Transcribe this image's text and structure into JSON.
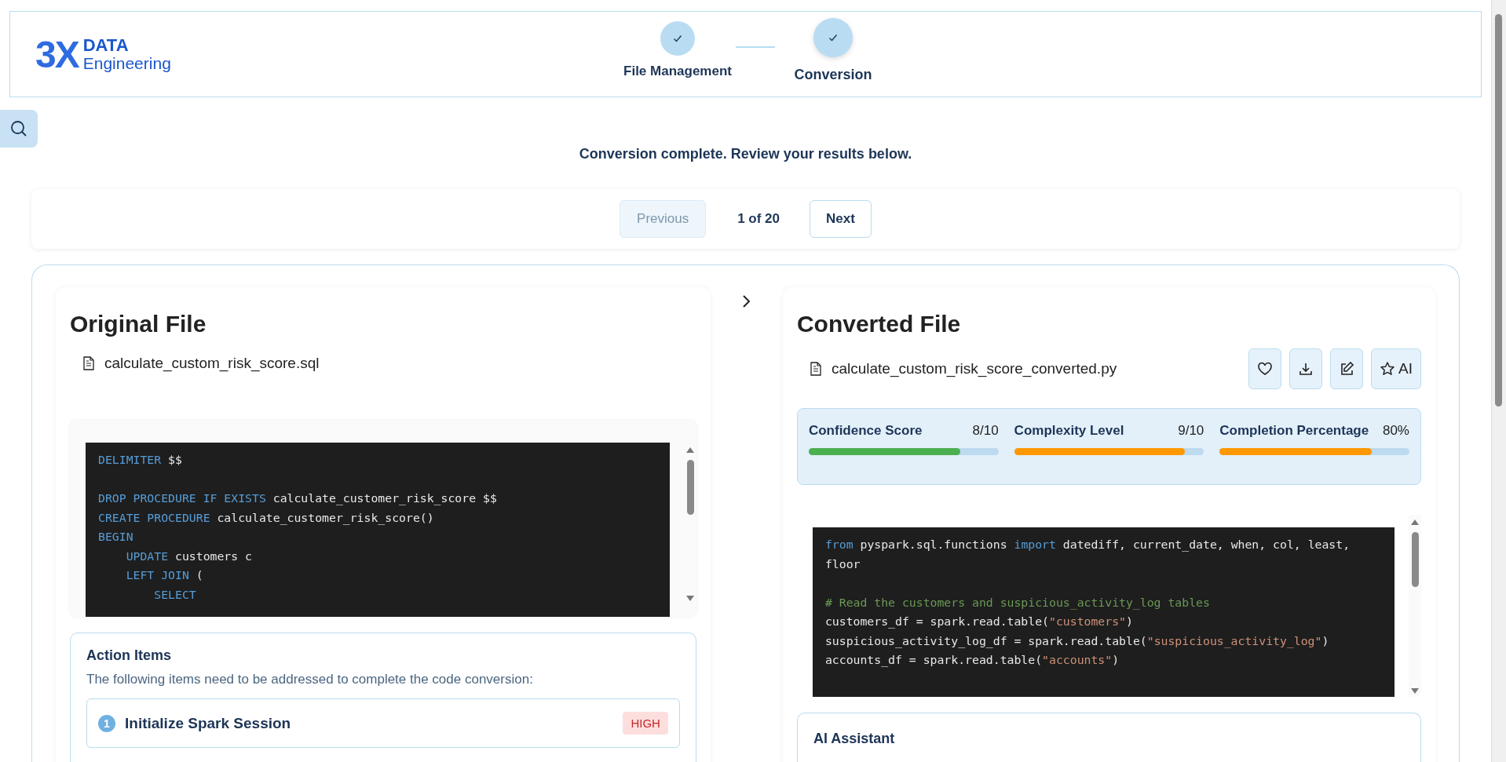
{
  "header": {
    "logo": {
      "mark": "3X",
      "line_1": "DATA",
      "line_2": "Engineering"
    },
    "steps": [
      {
        "label": "File Management",
        "done": true,
        "selected": false
      },
      {
        "label": "Conversion",
        "done": true,
        "selected": true
      }
    ]
  },
  "status_message": "Conversion complete. Review your results below.",
  "pagination": {
    "previous": {
      "label": "Previous",
      "disabled": true
    },
    "position": "1 of 20",
    "next": {
      "label": "Next",
      "disabled": false
    }
  },
  "original": {
    "title": "Original File",
    "file_name": "calculate_custom_risk_score.sql",
    "code": [
      {
        "tokens": [
          {
            "kind": "keyword",
            "text": "DELIMITER"
          },
          {
            "kind": "plain",
            "text": " $$"
          }
        ]
      },
      {
        "gap_before": true,
        "tokens": [
          {
            "kind": "keyword",
            "text": "DROP PROCEDURE IF EXISTS"
          },
          {
            "kind": "plain",
            "text": " calculate_customer_risk_score $$"
          }
        ]
      },
      {
        "tokens": [
          {
            "kind": "keyword",
            "text": "CREATE PROCEDURE"
          },
          {
            "kind": "plain",
            "text": " calculate_customer_risk_score()"
          }
        ]
      },
      {
        "tokens": [
          {
            "kind": "keyword",
            "text": "BEGIN"
          }
        ]
      },
      {
        "tokens": [
          {
            "kind": "keyword",
            "text": "    UPDATE"
          },
          {
            "kind": "plain",
            "text": " customers c"
          }
        ]
      },
      {
        "tokens": [
          {
            "kind": "keyword",
            "text": "    LEFT JOIN"
          },
          {
            "kind": "plain",
            "text": " ("
          }
        ]
      },
      {
        "tokens": [
          {
            "kind": "keyword",
            "text": "        SELECT"
          }
        ]
      }
    ],
    "action_items": {
      "title": "Action Items",
      "intro": "The following items need to be addressed to complete the code conversion:",
      "items": [
        {
          "number": "1",
          "title": "Initialize Spark Session",
          "priority": "HIGH",
          "color": "#fddede"
        }
      ]
    }
  },
  "converted": {
    "title": "Converted File",
    "file_name": "calculate_custom_risk_score_converted.py",
    "actions": [
      {
        "kind": "favorite"
      },
      {
        "kind": "download"
      },
      {
        "kind": "edit"
      },
      {
        "kind": "ai",
        "label": "AI"
      }
    ],
    "metrics": [
      {
        "label": "Confidence Score",
        "reading": "8/10",
        "level": 0.8,
        "color": "#4caf50"
      },
      {
        "label": "Complexity Level",
        "reading": "9/10",
        "level": 0.9,
        "color": "#ff9800"
      },
      {
        "label": "Completion Percentage",
        "reading": "80%",
        "level": 0.8,
        "color": "#ff9800"
      }
    ],
    "code": [
      {
        "tokens": [
          {
            "kind": "keyword",
            "text": "from"
          },
          {
            "kind": "plain",
            "text": " pyspark.sql.functions "
          },
          {
            "kind": "keyword",
            "text": "import"
          },
          {
            "kind": "plain",
            "text": " datediff, current_date, when, col, least, floor"
          }
        ]
      },
      {
        "gap_before": true,
        "tokens": [
          {
            "kind": "comment",
            "text": "# Read the customers and suspicious_activity_log tables"
          }
        ]
      },
      {
        "tokens": [
          {
            "kind": "plain",
            "text": "customers_df = spark.read.table("
          },
          {
            "kind": "string",
            "text": "\"customers\""
          },
          {
            "kind": "plain",
            "text": ")"
          }
        ]
      },
      {
        "tokens": [
          {
            "kind": "plain",
            "text": "suspicious_activity_log_df = spark.read.table("
          },
          {
            "kind": "string",
            "text": "\"suspicious_activity_log\""
          },
          {
            "kind": "plain",
            "text": ")"
          }
        ]
      },
      {
        "tokens": [
          {
            "kind": "plain",
            "text": "accounts_df = spark.read.table("
          },
          {
            "kind": "string",
            "text": "\"accounts\""
          },
          {
            "kind": "plain",
            "text": ")"
          }
        ]
      }
    ],
    "assistant": {
      "title": "AI Assistant"
    }
  }
}
